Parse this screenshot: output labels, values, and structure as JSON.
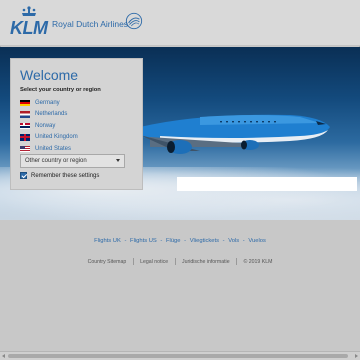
{
  "header": {
    "brand": "KLM",
    "tagline": "Royal Dutch Airlines",
    "logo_icon": "klm-crown-icon",
    "alliance_icon": "skyteam-icon"
  },
  "welcome": {
    "title": "Welcome",
    "subtitle": "Select your country or region",
    "countries": [
      {
        "label": "Germany",
        "flag": "de-flag-icon"
      },
      {
        "label": "Netherlands",
        "flag": "nl-flag-icon"
      },
      {
        "label": "Norway",
        "flag": "no-flag-icon"
      },
      {
        "label": "United Kingdom",
        "flag": "uk-flag-icon"
      },
      {
        "label": "United States",
        "flag": "us-flag-icon"
      }
    ],
    "other_select": "Other country or region",
    "remember": "Remember these settings",
    "remember_checked": true
  },
  "footer": {
    "links": [
      "Flights UK",
      "Flights US",
      "Flüge",
      "Vliegtickets",
      "Vols",
      "Vuelos"
    ],
    "link_separator": "-",
    "legal": [
      "Country Sitemap",
      "Legal notice",
      "Juridische informatie",
      "© 2019 KLM"
    ]
  },
  "colors": {
    "brand_blue": "#2d6aa8",
    "overlay_grey": "#c8c8c8"
  }
}
